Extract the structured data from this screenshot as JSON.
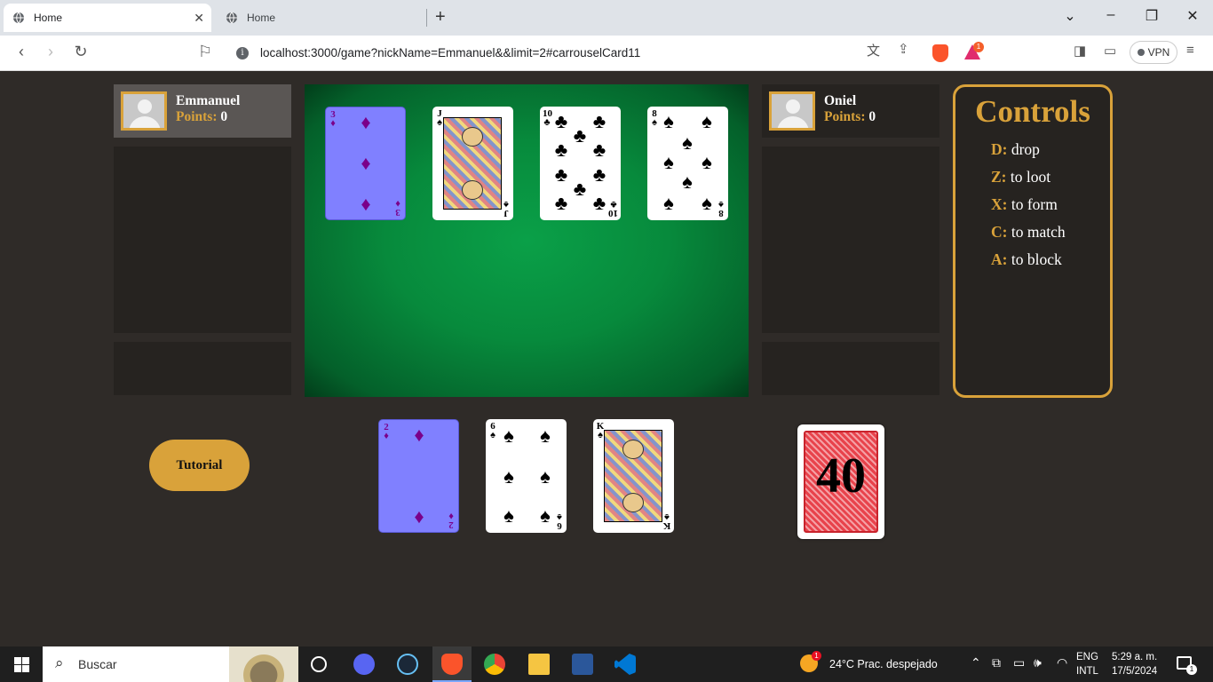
{
  "browser": {
    "tabs": [
      {
        "title": "Home",
        "active": true
      },
      {
        "title": "Home",
        "active": false
      }
    ],
    "url": "localhost:3000/game?nickName=Emmanuel&&limit=2#carrouselCard11",
    "brave_rewards_badge": "1",
    "vpn_label": "VPN"
  },
  "players": [
    {
      "name": "Emmanuel",
      "points_label": "Points:",
      "points": "0"
    },
    {
      "name": "Oniel",
      "points_label": "Points:",
      "points": "0"
    }
  ],
  "table_cards": [
    {
      "rank": "3",
      "suit": "diamonds",
      "selected": true
    },
    {
      "rank": "J",
      "suit": "spades",
      "selected": false
    },
    {
      "rank": "10",
      "suit": "clubs",
      "selected": false
    },
    {
      "rank": "8",
      "suit": "spades",
      "selected": false
    }
  ],
  "hand_cards": [
    {
      "rank": "2",
      "suit": "diamonds",
      "selected": true
    },
    {
      "rank": "6",
      "suit": "spades",
      "selected": false
    },
    {
      "rank": "K",
      "suit": "spades",
      "selected": false
    }
  ],
  "deck": {
    "count": "40"
  },
  "tutorial_label": "Tutorial",
  "controls": {
    "title": "Controls",
    "items": [
      {
        "key": "D:",
        "action": "drop"
      },
      {
        "key": "Z:",
        "action": "to loot"
      },
      {
        "key": "X:",
        "action": "to form"
      },
      {
        "key": "C:",
        "action": "to match"
      },
      {
        "key": "A:",
        "action": "to block"
      }
    ]
  },
  "taskbar": {
    "search_placeholder": "Buscar",
    "weather_badge": "1",
    "weather": "24°C  Prac. despejado",
    "lang_1": "ENG",
    "lang_2": "INTL",
    "time": "5:29 a. m.",
    "date": "17/5/2024",
    "notification_count": "1"
  },
  "colors": {
    "accent": "#d9a23a",
    "table_green": "#078a3c",
    "background": "#2f2b28",
    "selected_card": "#8080ff"
  }
}
